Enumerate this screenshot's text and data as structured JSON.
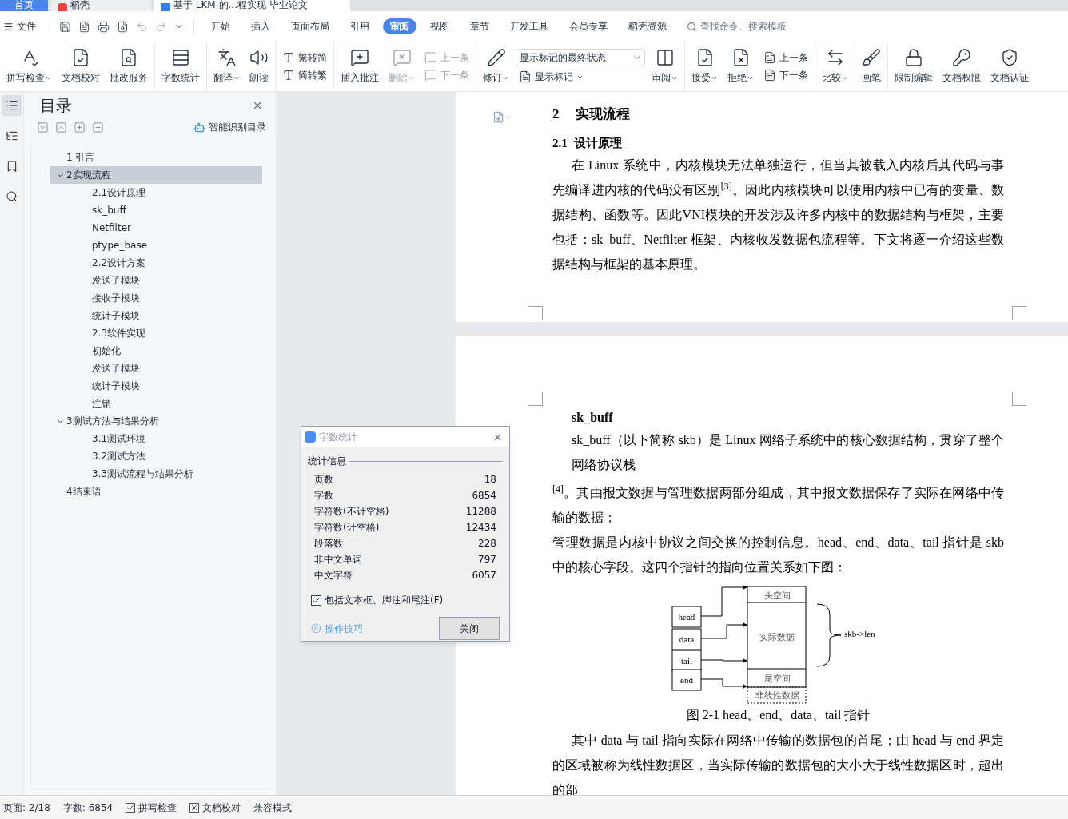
{
  "window_tabs": [
    {
      "label": "首页",
      "selected": false,
      "kind": "home"
    },
    {
      "label": "稻壳",
      "selected": false,
      "kind": "app"
    },
    {
      "label": "基于 LKM 的...程实现 毕业论文",
      "selected": true,
      "kind": "doc"
    }
  ],
  "menu": {
    "file": "文件",
    "tabs": [
      {
        "label": "开始",
        "selected": false
      },
      {
        "label": "插入",
        "selected": false
      },
      {
        "label": "页面布局",
        "selected": false
      },
      {
        "label": "引用",
        "selected": false
      },
      {
        "label": "审阅",
        "selected": true
      },
      {
        "label": "视图",
        "selected": false
      },
      {
        "label": "章节",
        "selected": false
      },
      {
        "label": "开发工具",
        "selected": false
      },
      {
        "label": "会员专享",
        "selected": false
      },
      {
        "label": "稻壳资源",
        "selected": false
      }
    ],
    "search_placeholder": "查找命令、搜索模板"
  },
  "ribbon": {
    "groups": [
      [
        {
          "kind": "large",
          "label": "拼写检查",
          "dropdown": true,
          "disabled": false
        },
        {
          "kind": "large",
          "label": "文档校对",
          "dropdown": false,
          "disabled": false
        },
        {
          "kind": "large",
          "label": "批改服务",
          "dropdown": false,
          "disabled": false
        }
      ],
      [
        {
          "kind": "large",
          "label": "字数统计",
          "dropdown": false,
          "disabled": false
        }
      ],
      [
        {
          "kind": "large",
          "label": "翻译",
          "dropdown": true,
          "disabled": false
        },
        {
          "kind": "large",
          "label": "朗读",
          "dropdown": false,
          "disabled": false
        }
      ],
      [
        {
          "kind": "pair",
          "rows": [
            {
              "label": "繁转简",
              "disabled": false
            },
            {
              "label": "简转繁",
              "disabled": false
            }
          ]
        }
      ],
      [
        {
          "kind": "large",
          "label": "插入批注",
          "dropdown": false,
          "disabled": false
        },
        {
          "kind": "large",
          "label": "删除",
          "dropdown": true,
          "disabled": true
        },
        {
          "kind": "pair",
          "rows": [
            {
              "label": "上一条",
              "disabled": true
            },
            {
              "label": "下一条",
              "disabled": true
            }
          ]
        }
      ],
      [
        {
          "kind": "large",
          "label": "修订",
          "dropdown": true,
          "disabled": false
        },
        {
          "kind": "combo",
          "value": "显示标记的最终状态",
          "label": "显示标记"
        },
        {
          "kind": "large",
          "label": "审阅",
          "dropdown": true,
          "disabled": false
        }
      ],
      [
        {
          "kind": "large",
          "label": "接受",
          "dropdown": true,
          "disabled": false
        },
        {
          "kind": "large",
          "label": "拒绝",
          "dropdown": true,
          "disabled": false
        },
        {
          "kind": "pair",
          "rows": [
            {
              "label": "上一条",
              "disabled": false
            },
            {
              "label": "下一条",
              "disabled": false
            }
          ]
        }
      ],
      [
        {
          "kind": "large",
          "label": "比较",
          "dropdown": true,
          "disabled": false
        }
      ],
      [
        {
          "kind": "large",
          "label": "画笔",
          "dropdown": false,
          "disabled": false
        }
      ],
      [
        {
          "kind": "large",
          "label": "限制编辑",
          "dropdown": false,
          "disabled": false
        },
        {
          "kind": "large",
          "label": "文档权限",
          "dropdown": false,
          "disabled": false
        },
        {
          "kind": "large",
          "label": "文档认证",
          "dropdown": false,
          "disabled": false
        }
      ]
    ]
  },
  "sidebar_tabs": [
    {
      "selected": true
    },
    {
      "selected": false
    },
    {
      "selected": false
    },
    {
      "selected": false
    }
  ],
  "toc": {
    "title": "目录",
    "smart_button": "智能识别目录",
    "items": [
      {
        "label": "1 引言",
        "selected": false
      },
      {
        "label": "2实现流程",
        "selected": true,
        "expanded": true,
        "children": [
          {
            "label": "2.1设计原理"
          },
          {
            "label": "sk_buff"
          },
          {
            "label": "Netfilter"
          },
          {
            "label": "ptype_base"
          },
          {
            "label": "2.2设计方案"
          },
          {
            "label": "发送子模块"
          },
          {
            "label": "接收子模块"
          },
          {
            "label": "统计子模块"
          },
          {
            "label": "2.3软件实现"
          },
          {
            "label": "初始化"
          },
          {
            "label": "发送子模块"
          },
          {
            "label": "统计子模块"
          },
          {
            "label": "注销"
          }
        ]
      },
      {
        "label": "3测试方法与结果分析",
        "selected": false,
        "expanded": true,
        "children": [
          {
            "label": "3.1测试环境"
          },
          {
            "label": "3.2测试方法"
          },
          {
            "label": "3.3测试流程与结果分析"
          }
        ]
      },
      {
        "label": "4结束语",
        "selected": false
      }
    ]
  },
  "dialog": {
    "title": "字数统计",
    "section": "统计信息",
    "rows": [
      {
        "label": "页数",
        "value": "18"
      },
      {
        "label": "字数",
        "value": "6854"
      },
      {
        "label": "字符数(不计空格)",
        "value": "11288"
      },
      {
        "label": "字符数(计空格)",
        "value": "12434"
      },
      {
        "label": "段落数",
        "value": "228"
      },
      {
        "label": "非中文单词",
        "value": "797"
      },
      {
        "label": "中文字符",
        "value": "6057"
      }
    ],
    "checkbox": {
      "label": "包括文本框、脚注和尾注(F)",
      "checked": true
    },
    "tips_link": "操作技巧",
    "close_button": "关闭"
  },
  "page1": {
    "heading": {
      "number": "2",
      "text": "实现流程"
    },
    "subheading": {
      "number": "2.1",
      "text": "设计原理"
    },
    "paragraph": "在 Linux 系统中，内核模块无法单独运行，但当其被载入内核后其代码与事先编译进内核的代码没有区别$^{[3]}$。因此内核模块可以使用内核中已有的变量、数据结构、函数等。因此VNI模块的开发涉及许多内核中的数据结构与框架，主要包括：sk_buff、Netfilter 框架、内核收发数据包流程等。下文将逐一介绍这些数据结构与框架的基本原理。"
  },
  "page2": {
    "heading": "sk_buff",
    "para1": "sk_buff（以下简称 skb）是 Linux 网络子系统中的核心数据结构，贯穿了整个网络协议栈",
    "para2": "$^{[4]}$。其由报文数据与管理数据两部分组成，其中报文数据保存了实际在网络中传输的数据；",
    "para3": "管理数据是内核中协议之间交换的控制信息。head、end、data、tail 指针是 skb 中的核心字段。这四个指针的指向位置关系如下图：",
    "figure": {
      "pointers": [
        "head",
        "data",
        "tail",
        "end"
      ],
      "regions": [
        "头空间",
        "实际数据",
        "尾空间"
      ],
      "nonlinear": "非线性数据",
      "brace_label": "skb->len"
    },
    "caption": "图 2-1 head、end、data、tail 指针",
    "para4": "其中 data 与 tail 指向实际在网络中传输的数据包的首尾；由 head 与 end 界定的区域被称为线性数据区，当实际传输的数据包的大小大于线性数据区时，超出的部"
  },
  "status_bar": {
    "page": "页面: 2/18",
    "words": "字数: 6854",
    "items": [
      {
        "label": "拼写检查",
        "kind": "check"
      },
      {
        "label": "文档校对",
        "kind": "xbox"
      },
      {
        "label": "兼容模式",
        "kind": "plain"
      }
    ]
  }
}
